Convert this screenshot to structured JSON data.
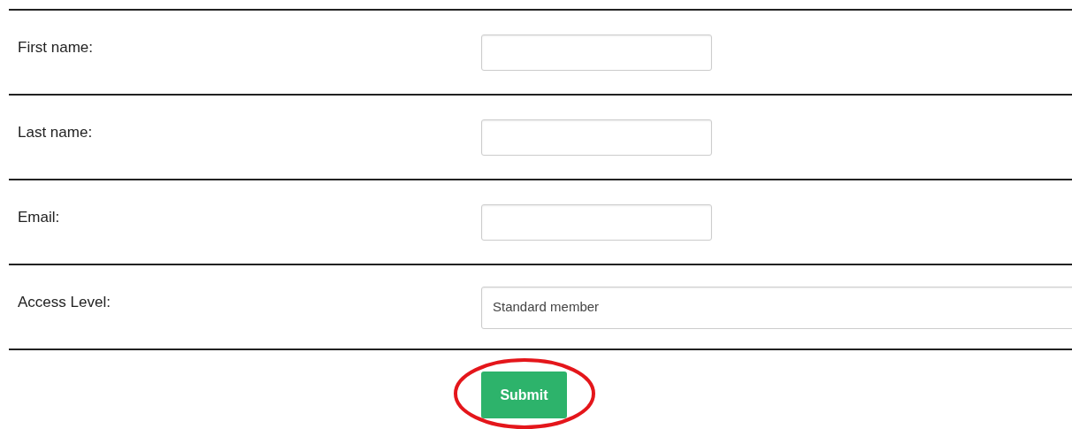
{
  "fields": [
    {
      "kind": "text",
      "label": "First name:"
    },
    {
      "kind": "text",
      "label": "Last name:"
    },
    {
      "kind": "text",
      "label": "Email:"
    },
    {
      "kind": "select",
      "label": "Access Level:",
      "value": "Standard member"
    }
  ],
  "submit": {
    "label": "Submit",
    "highlighted": true
  }
}
